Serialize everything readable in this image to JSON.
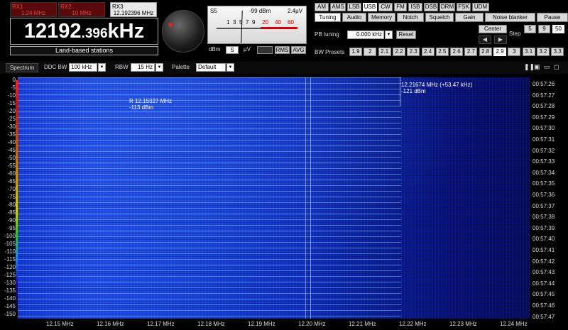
{
  "receivers": [
    {
      "name": "RX1",
      "freq": "1.24 MHz",
      "active": false
    },
    {
      "name": "RX2",
      "freq": "10 MHz",
      "active": false
    },
    {
      "name": "RX3",
      "freq": "12.192396 MHz",
      "active": true
    }
  ],
  "frequency": {
    "main": "12192",
    "sub": ".396",
    "unit": "kHz"
  },
  "band_label": "Land-based stations",
  "meter": {
    "s_label": "S5",
    "dbm": "-99 dBm",
    "uv": "2.4μV",
    "scale_black": [
      "1",
      "3",
      "5",
      "7",
      "9"
    ],
    "scale_red": [
      "20",
      "40",
      "60"
    ],
    "dbm_label": "dBm",
    "s_btn": "S",
    "uv_btn": "μV",
    "rms_btn": "RMS",
    "avg_btn": "AVG"
  },
  "modes": [
    "AM",
    "AMS",
    "LSB",
    "USB",
    "CW",
    "FM",
    "ISB",
    "DSB",
    "DRM",
    "FSK",
    "UDM"
  ],
  "selected_mode": "USB",
  "tabs": [
    "Tuning",
    "Audio",
    "Memory",
    "Notch",
    "Squelch",
    "Gain",
    "Noise blanker",
    "Pause"
  ],
  "selected_tab": "Tuning",
  "tuning": {
    "pb_label": "PB tuning",
    "pb_value": "0.000 kHz",
    "reset": "Reset",
    "center": "Center",
    "step_label": "Step",
    "steps": [
      "5",
      "9",
      "50"
    ],
    "selected_step": "50",
    "bw_label": "BW Presets",
    "bw": [
      "1.9",
      "2",
      "2.1",
      "2.2",
      "2.3",
      "2.4",
      "2.5",
      "2.6",
      "2.7",
      "2.8",
      "2.9",
      "3",
      "3.1",
      "3.2",
      "3.3"
    ],
    "selected_bw": "2.9"
  },
  "toolbar": {
    "spectrum": "Spectrum",
    "ddc_label": "DDC BW",
    "ddc_value": "100 kHz",
    "rbw_label": "RBW",
    "rbw_value": "15 Hz",
    "palette_label": "Palette",
    "palette_value": "Default"
  },
  "waterfall": {
    "marker1": {
      "line1": "R 12.15327 MHz",
      "line2": "-113 dBm"
    },
    "marker2": {
      "line1": "12.21674 MHz (+53.47 kHz)",
      "line2": "-121 dBm"
    },
    "y_labels": [
      "0",
      "-5",
      "-10",
      "-15",
      "-20",
      "-25",
      "-30",
      "-35",
      "-40",
      "-45",
      "-50",
      "-55",
      "-60",
      "-65",
      "-70",
      "-75",
      "-80",
      "-85",
      "-90",
      "-95",
      "-100",
      "-105",
      "-110",
      "-115",
      "-120",
      "-125",
      "-130",
      "-135",
      "-140",
      "-145",
      "-150"
    ],
    "times": [
      "00:57:26",
      "00:57:27",
      "00:57:28",
      "00:57:29",
      "00:57:30",
      "00:57:31",
      "00:57:32",
      "00:57:33",
      "00:57:34",
      "00:57:35",
      "00:57:36",
      "00:57:37",
      "00:57:38",
      "00:57:39",
      "00:57:40",
      "00:57:41",
      "00:57:42",
      "00:57:43",
      "00:57:44",
      "00:57:45",
      "00:57:46",
      "00:57:47"
    ],
    "x_labels": [
      "12.15 MHz",
      "12.16 MHz",
      "12.17 MHz",
      "12.18 MHz",
      "12.19 MHz",
      "12.20 MHz",
      "12.21 MHz",
      "12.22 MHz",
      "12.23 MHz",
      "12.24 MHz"
    ]
  }
}
